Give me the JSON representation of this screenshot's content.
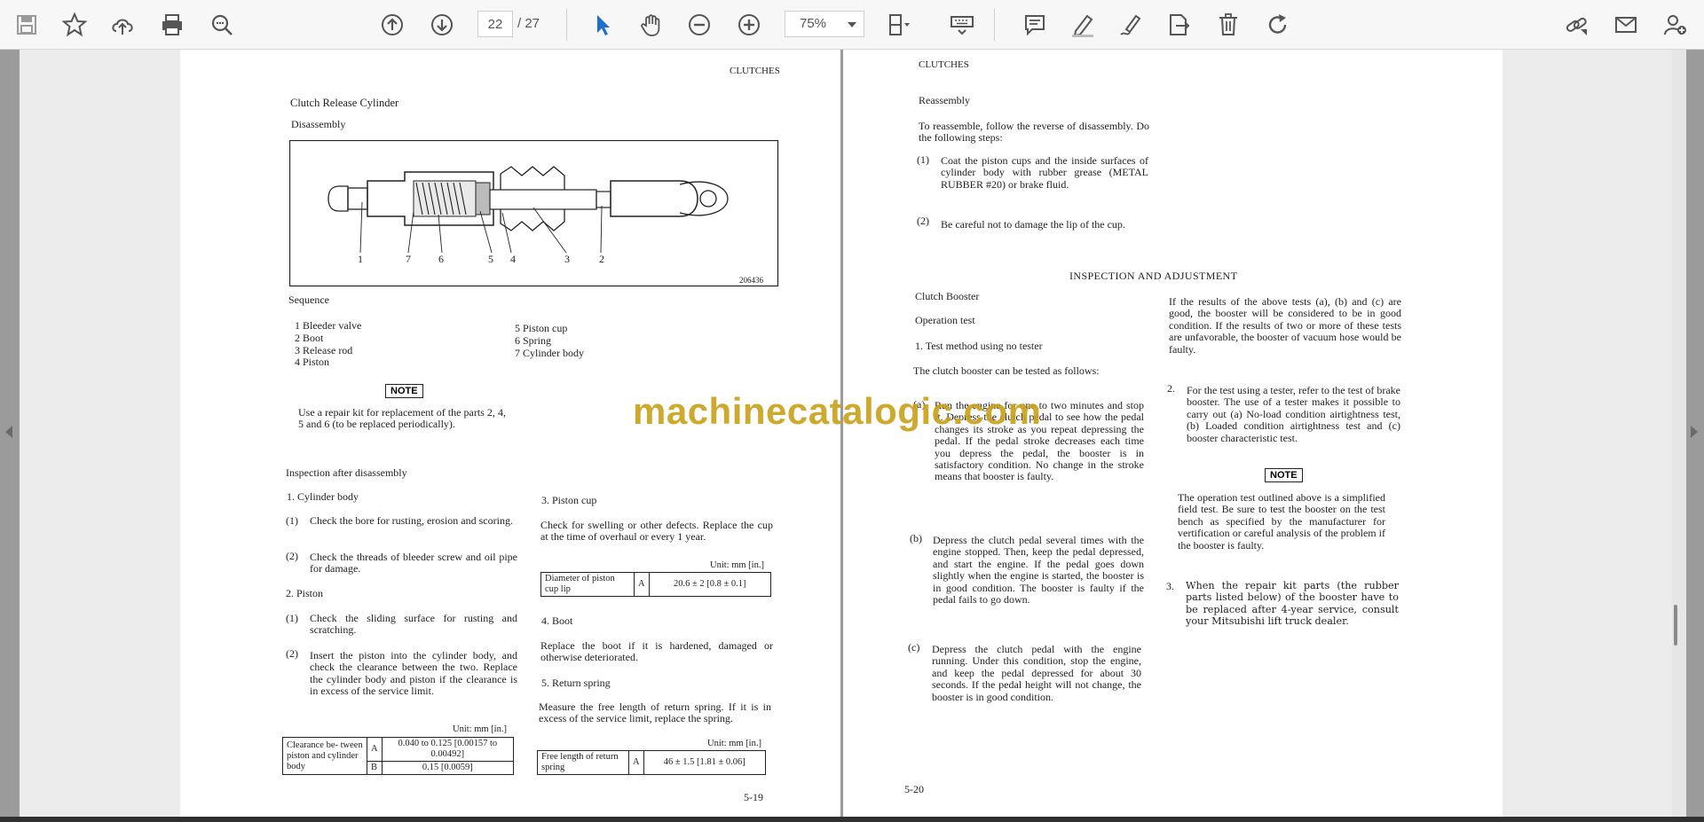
{
  "toolbar": {
    "page_current": "22",
    "page_total": "/ 27",
    "zoom": "75%",
    "icons": [
      "save-icon",
      "bookmark-star-icon",
      "upload-cloud-icon",
      "print-icon",
      "find-zoom-icon",
      "page-up-icon",
      "page-down-icon",
      "select-cursor-icon",
      "hand-pan-icon",
      "zoom-out-icon",
      "zoom-in-icon",
      "fit-page-icon",
      "keyboard-icon",
      "comment-icon",
      "highlight-pen-icon",
      "sign-pen-icon",
      "export-icon",
      "delete-icon",
      "redo-icon",
      "share-link-icon",
      "mail-icon",
      "add-user-icon"
    ]
  },
  "watermark": "machinecatalogic.com",
  "left_page": {
    "header": "CLUTCHES",
    "title": "Clutch Release Cylinder",
    "disassembly": "Disassembly",
    "figure_number": "206436",
    "callouts": [
      "1",
      "7",
      "6",
      "5",
      "4",
      "3",
      "2"
    ],
    "sequence_label": "Sequence",
    "sequence_left": [
      "1 Bleeder valve",
      "2 Boot",
      "3 Release rod",
      "4 Piston"
    ],
    "sequence_right": [
      "5 Piston cup",
      "6 Spring",
      "7 Cylinder body"
    ],
    "note_label": "NOTE",
    "note_text": "Use a repair kit for replacement of the parts 2, 4, 5 and 6 (to be replaced periodically).",
    "inspection_heading": "Inspection after disassembly",
    "cyl_heading": "1.  Cylinder body",
    "cyl_1_num": "(1)",
    "cyl_1": "Check the bore for rusting, erosion and scoring.",
    "cyl_2_num": "(2)",
    "cyl_2": "Check the threads of bleeder screw and oil pipe for damage.",
    "piston_heading": "2.  Piston",
    "piston_1_num": "(1)",
    "piston_1": "Check the sliding surface for rusting and scratching.",
    "piston_2_num": "(2)",
    "piston_2": "Insert the piston into the cylinder body, and check the clearance between the two. Replace the cylinder body and piston if the clearance is in excess of the service limit.",
    "unit": "Unit: mm [in.]",
    "clear_label": "Clearance be- tween piston and cylinder body",
    "clear_A": "A",
    "clear_A_val": "0.040 to 0.125 [0.00157 to 0.00492]",
    "clear_B": "B",
    "clear_B_val": "0.15 [0.0059]",
    "cup_heading": "3.  Piston cup",
    "cup_text": "Check for swelling or other defects. Replace the cup at the time of overhaul or every 1 year.",
    "cup_unit": "Unit: mm [in.]",
    "cup_label": "Diameter of piston cup lip",
    "cup_A": "A",
    "cup_val": "20.6 ± 2 [0.8 ± 0.1]",
    "boot_heading": "4.  Boot",
    "boot_text": "Replace the boot if it is hardened, damaged or otherwise deteriorated.",
    "spring_heading": "5.  Return spring",
    "spring_text": "Measure the free length of return spring. If it is in excess of the service limit, replace the spring.",
    "spring_unit": "Unit: mm [in.]",
    "spring_label": "Free length of return spring",
    "spring_A": "A",
    "spring_val": "46 ± 1.5 [1.81 ± 0.06]",
    "page_number": "5-19"
  },
  "right_page": {
    "header": "CLUTCHES",
    "reassembly": "Reassembly",
    "reassembly_text": "To reassemble, follow the reverse of disassembly. Do the following steps:",
    "step1_num": "(1)",
    "step1": "Coat the piston cups and the inside surfaces of cylinder body with rubber grease (METAL RUBBER #20) or brake fluid.",
    "step2_num": "(2)",
    "step2": "Be careful not to damage the lip of the cup.",
    "insp_heading": "INSPECTION AND ADJUSTMENT",
    "booster": "Clutch Booster",
    "op_test": "Operation test",
    "method": "1.  Test method using no tester",
    "method_text": "The clutch booster can be tested as follows:",
    "a_num": "(a)",
    "a_text": "Run the engine for one to two minutes and stop it. Depress the clutch pedal to see how the pedal changes its stroke as you repeat depressing the pedal. If the pedal stroke decreases each time you depress the pedal, the booster is in satisfactory condition. No change in the stroke means that booster is faulty.",
    "b_num": "(b)",
    "b_text": "Depress the clutch pedal several times with the engine stopped. Then, keep the pedal depressed, and start the engine. If the pedal goes down slightly when the engine is started, the booster is in good condition. The booster is faulty if the pedal fails to go down.",
    "c_num": "(c)",
    "c_text": "Depress the clutch pedal with the engine running. Under this condition, stop the engine, and keep the pedal depressed for about 30 seconds. If the pedal height will not change, the booster is in good condition.",
    "results_text": "If the results of the above tests (a), (b) and (c) are good, the booster will be considered to be in good condition. If the results of two or more of these tests are unfavorable, the booster of vacuum hose would be faulty.",
    "test2_num": "2.",
    "test2": "For the test using a tester, refer to the test of brake booster. The use of a tester makes it possible to carry out (a) No-load condition airtightness test, (b) Loaded condition airtightness test and (c) booster characteristic test.",
    "note_label": "NOTE",
    "note_text": "The operation test outlined above is a simplified field test. Be sure to test the booster on the test bench as specified by the manufacturer for vertification or careful analysis of the problem if the booster is faulty.",
    "test3_num": "3.",
    "test3": "When the repair kit parts (the rubber parts listed below) of the booster have to be replaced after 4-year service, consult your Mitsubishi lift truck dealer.",
    "page_number": "5-20"
  }
}
